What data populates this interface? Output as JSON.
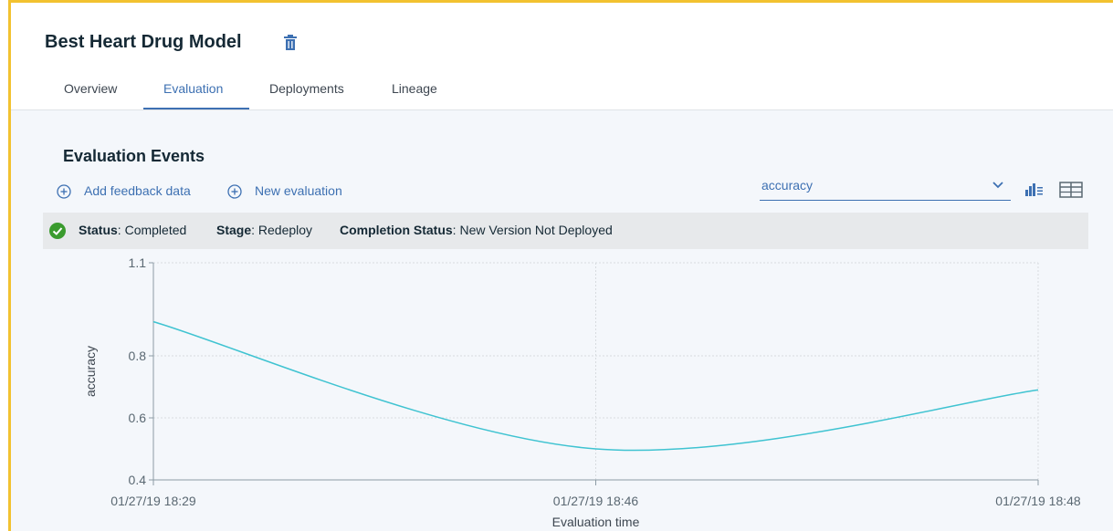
{
  "header": {
    "title": "Best Heart Drug Model",
    "tabs": [
      {
        "label": "Overview"
      },
      {
        "label": "Evaluation"
      },
      {
        "label": "Deployments"
      },
      {
        "label": "Lineage"
      }
    ],
    "active_tab": "Evaluation"
  },
  "main": {
    "section_title": "Evaluation Events",
    "actions": {
      "add_feedback": "Add feedback data",
      "new_evaluation": "New evaluation"
    },
    "metric_select": {
      "value": "accuracy"
    },
    "status": {
      "status_key": "Status",
      "status_value": "Completed",
      "stage_key": "Stage",
      "stage_value": "Redeploy",
      "completion_key": "Completion Status",
      "completion_value": "New Version Not Deployed"
    }
  },
  "colors": {
    "accent": "#3d70b2",
    "line": "#3fc3d1",
    "success": "#3a9b2e",
    "highlight_border": "#f2c230"
  },
  "chart_data": {
    "type": "line",
    "title": "",
    "xlabel": "Evaluation time",
    "ylabel": "accuracy",
    "x": [
      "01/27/19 18:29",
      "01/27/19 18:46",
      "01/27/19 18:48"
    ],
    "y_ticks": [
      "0.4",
      "0.6",
      "0.8",
      "1.1"
    ],
    "ylim": [
      0.4,
      1.1
    ],
    "grid": true,
    "series": [
      {
        "values": [
          0.91,
          0.5,
          0.69
        ]
      }
    ]
  }
}
